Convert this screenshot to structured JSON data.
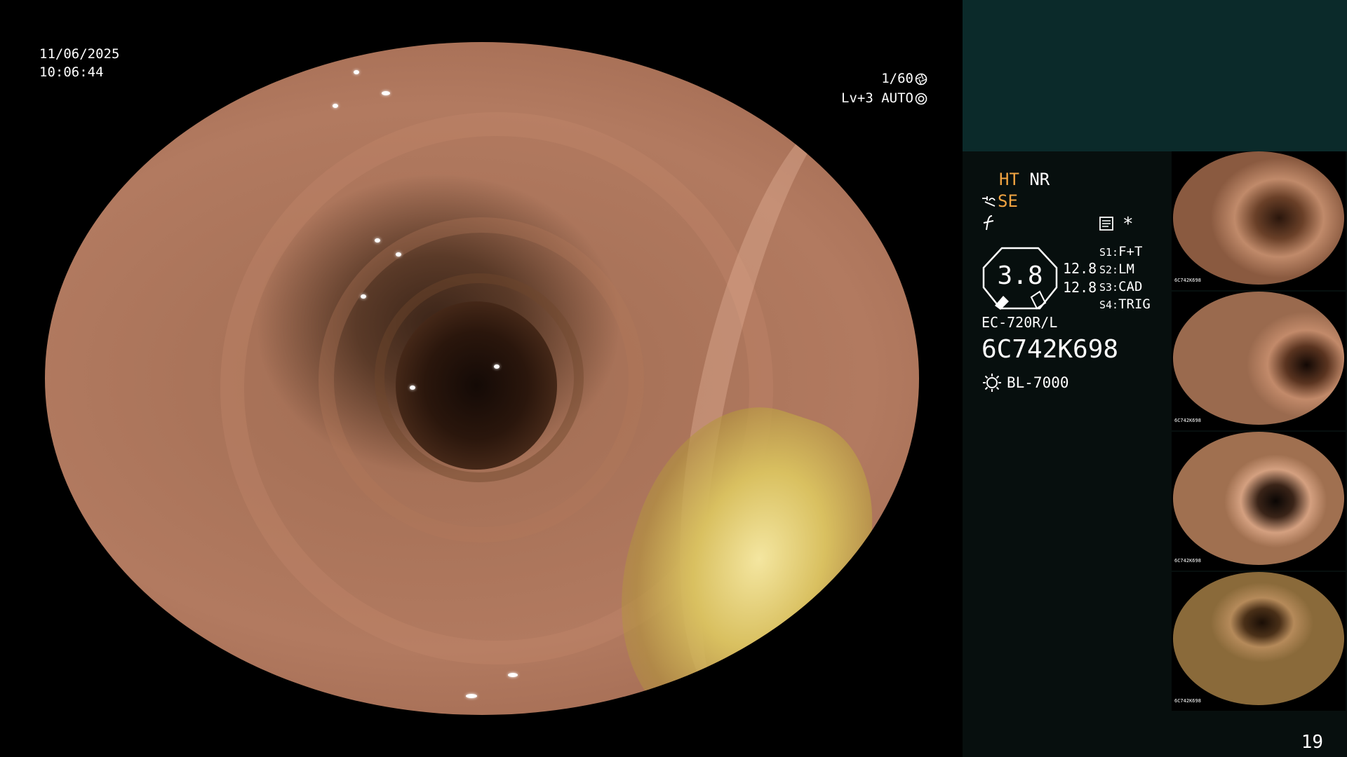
{
  "overlay": {
    "date": "11/06/2025",
    "time": "10:06:44",
    "shutter": "1/60",
    "level": "Lv+3 AUTO"
  },
  "status": {
    "ht": "HT",
    "nr": "NR",
    "se": "SE",
    "brightness": "3.8",
    "zoom_1": "12.8",
    "zoom_2": "12.8"
  },
  "switches": [
    {
      "key": "S1:",
      "value": "F+T"
    },
    {
      "key": "S2:",
      "value": "LM"
    },
    {
      "key": "S3:",
      "value": "CAD"
    },
    {
      "key": "S4:",
      "value": "TRIG"
    }
  ],
  "scope": {
    "model": "EC-720R/L",
    "serial": "6C742K698",
    "light_source": "BL-7000"
  },
  "page_number": "19",
  "colors": {
    "accent": "#f2a441",
    "panel_top": "#0b2a2a",
    "panel": "#070f0e"
  },
  "icons": [
    "shutter-icon",
    "auto-iris-icon",
    "filter-icon",
    "memo-icon",
    "asterisk-icon",
    "light-source-icon",
    "scope-settings-icon"
  ]
}
